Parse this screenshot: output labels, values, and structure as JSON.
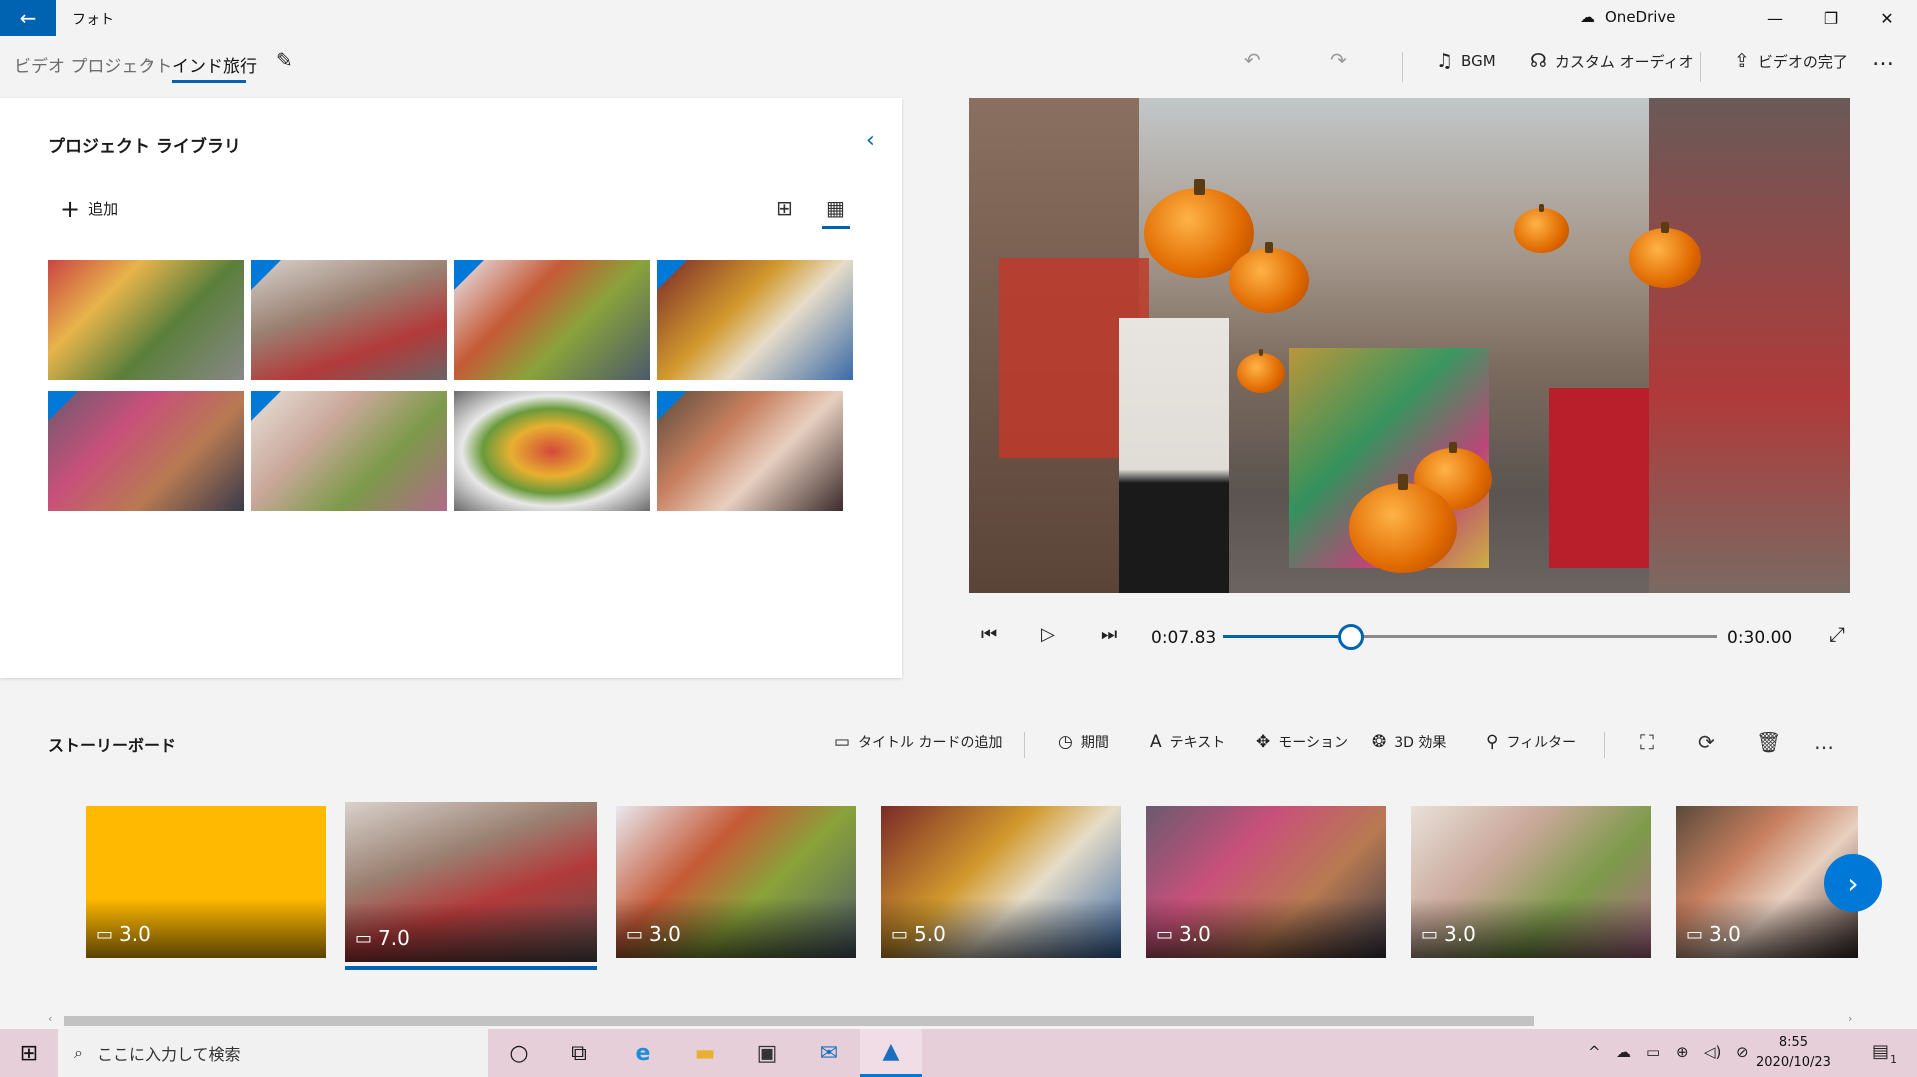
{
  "titlebar": {
    "back_icon": "←",
    "app_title": "フォト",
    "onedrive_label": "OneDrive",
    "onedrive_icon": "☁",
    "minimize": "—",
    "maximize": "❐",
    "close": "✕"
  },
  "breadcrumb": {
    "root": "ビデオ プロジェクト",
    "separator": "›",
    "current": "インド旅行",
    "edit_icon": "✎"
  },
  "toolbar": {
    "undo_icon": "↶",
    "redo_icon": "↷",
    "bgm_icon": "♫",
    "bgm_label": "BGM",
    "custom_audio_icon": "☊",
    "custom_audio_label": "カスタム オーディオ",
    "finish_icon": "⇪",
    "finish_label": "ビデオの完了",
    "more": "…"
  },
  "library": {
    "title": "プロジェクト ライブラリ",
    "collapse_icon": "‹",
    "add_icon": "+",
    "add_label": "追加",
    "view_large_icon": "⊞",
    "view_small_icon": "▦"
  },
  "preview": {
    "colors": {
      "street": "#7b6a5e",
      "pumpkin": "#e06a00"
    }
  },
  "playback": {
    "prev_icon": "⏮",
    "play_icon": "▷",
    "next_icon": "⏭",
    "current_time": "0:07.83",
    "total_time": "0:30.00",
    "progress": 0.26,
    "fullscreen_icon": "⤢"
  },
  "storyboard": {
    "title": "ストーリーボード",
    "tools": {
      "title_card_icon": "▭",
      "title_card": "タイトル カードの追加",
      "duration_icon": "◷",
      "duration": "期間",
      "text_icon": "A",
      "text": "テキスト",
      "motion_icon": "✥",
      "motion": "モーション",
      "effects_icon": "❂",
      "effects": "3D 効果",
      "filter_icon": "⚲",
      "filter": "フィルター",
      "crop_icon": "⛶",
      "rotate_icon": "⟳",
      "delete_icon": "🗑",
      "more": "…"
    },
    "clips": [
      {
        "duration": "3.0",
        "icon": "▭"
      },
      {
        "duration": "7.0",
        "icon": "▭"
      },
      {
        "duration": "3.0",
        "icon": "▭"
      },
      {
        "duration": "5.0",
        "icon": "▭"
      },
      {
        "duration": "3.0",
        "icon": "▭"
      },
      {
        "duration": "3.0",
        "icon": "▭"
      },
      {
        "duration": "3.0",
        "icon": "▭"
      }
    ],
    "next_icon": "›",
    "scroll_left": "‹",
    "scroll_right": "›"
  },
  "taskbar": {
    "start_icon": "⊞",
    "search_icon": "⌕",
    "search_placeholder": "ここに入力して検索",
    "cortana_icon": "○",
    "taskview_icon": "⧉",
    "edge_icon": "e",
    "explorer_icon": "▬",
    "store_icon": "▣",
    "mail_icon": "✉",
    "photos_icon": "▲",
    "tray_up": "^",
    "tray_cloud": "☁",
    "tray_battery": "▭",
    "tray_network": "⊕",
    "tray_volume": "◁)",
    "tray_mic": "⊘",
    "time": "8:55",
    "date": "2020/10/23",
    "notification_icon": "▤",
    "notification_count": "1"
  }
}
